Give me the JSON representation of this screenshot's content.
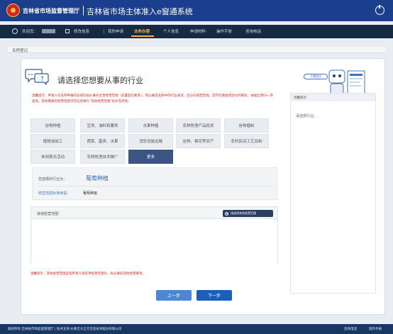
{
  "header": {
    "org_name": "吉林省市场监督管理厅",
    "system_title": "吉林省市场主体准入e窗通系统"
  },
  "navbar": {
    "welcome": "欢迎您：",
    "change_info": "修改信息",
    "items": [
      "我的申请",
      "业务办理",
      "个人信息",
      "申请材料",
      "操作手册",
      "咨询电话"
    ],
    "active_item": "业务办理"
  },
  "page": {
    "title": "名称登记"
  },
  "main": {
    "question": "请选择您想要从事的行业",
    "notice": "温馨提示：申请人在名称申报阶段填写拟从事的主营经营范围（前置登记要求），用以确定名称中的行业表述，区分与经营范围。若存在重复或近似的情形，依据启用同一项查询。其他需要的经营范围可在信息填写“其他经营范围”处补充完善。",
    "robot_label": "不懂就问",
    "hint_title": "温馨提示",
    "hint_text": "请选择行业。",
    "categories": [
      [
        "谷物种植",
        "豆类、油料和薯类",
        "水果种植",
        "农林牧渔产品批发",
        "谷物磨制"
      ],
      [
        "植物油加工",
        "蔬菜、菌类、水果",
        "消防设施运输",
        "谷物、棉花等农产",
        "农村民间工艺及制"
      ],
      [
        "休闲观光活动",
        "农林牧渔技术推广",
        "更多"
      ]
    ],
    "selected_label": "您选择的行业为：",
    "selected_value": "葡萄种植",
    "standard_label": "经营范围标准用语：",
    "standard_value": "葡萄种植",
    "other_label": "其他经营范围：",
    "other_button": "请选择其他经营范围",
    "other_placeholder": "",
    "tip2": "温馨提示：其他经营范围是指申请人除首项经营范围外，拟从事的其他经营事项。",
    "prev_button": "上一步",
    "next_button": "下一步"
  },
  "footer": {
    "copyright": "版权所有:吉林省市场监督管理厅 | 技术支持:长春吉大正元信息技术股份有限公司",
    "phone": "咨询电话",
    "manual": "操作手册"
  }
}
